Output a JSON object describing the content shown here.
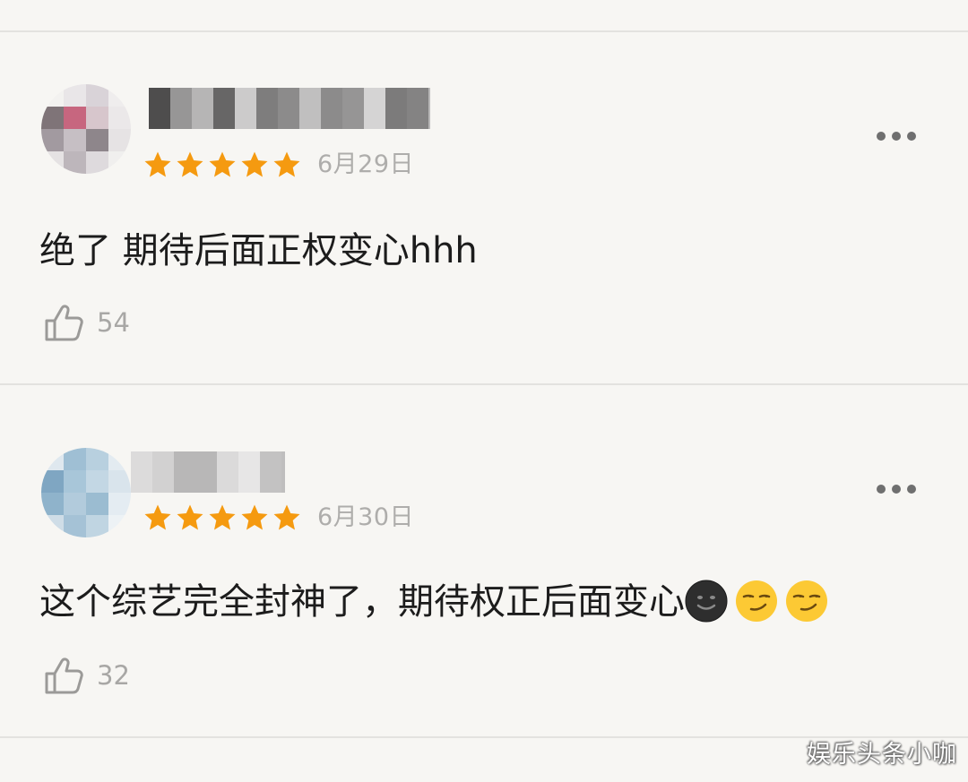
{
  "reviews": [
    {
      "rating": 5,
      "date": "6月29日",
      "content": "绝了 期待后面正权变心hhh",
      "emojis": [],
      "likes": "54",
      "avatar_palette": [
        "#f3f2f0",
        "#e9e6e8",
        "#d9d3d8",
        "#efeded",
        "#7f7478",
        "#c7667f",
        "#d7c6cc",
        "#ebe8e9",
        "#a29aa0",
        "#c6bfc4",
        "#8e868b",
        "#e6e3e4",
        "#e5e2e3",
        "#bdb6bb",
        "#dedadd",
        "#f0efee"
      ],
      "username_palette": [
        "#3b3b3b",
        "#6d6d6d",
        "#9a9a9a",
        "#565656",
        "#b9b9b9",
        "#4a4a4a",
        "#7f7f7f",
        "#a8a8a8",
        "#5e5e5e",
        "#8b8b8b",
        "#c6c6c6",
        "#474747",
        "#777777",
        "#a0a0a0"
      ]
    },
    {
      "rating": 5,
      "date": "6月30日",
      "content": "这个综艺完全封神了，期待权正后面变心",
      "emojis": [
        "dark-smiling-moon-face",
        "smirking-face",
        "smirking-face"
      ],
      "likes": "32",
      "avatar_palette": [
        "#dfe8ef",
        "#9fbfd4",
        "#b8d0df",
        "#e3ebf1",
        "#7fa6c2",
        "#a8c6d9",
        "#c3d7e4",
        "#d9e4ec",
        "#8fb3cb",
        "#b2cbdc",
        "#9bbcd1",
        "#e4ecf2",
        "#cfdde7",
        "#a5c2d6",
        "#c0d5e2",
        "#edf2f5"
      ],
      "username_palette": [
        "#d8d8d8",
        "#c2c2c2",
        "#9d9d9d",
        "#b0b0b0",
        "#cfcfcf",
        "#e0e0e0",
        "#bdbdbd",
        "#a7a7a7"
      ]
    }
  ],
  "watermark": "娱乐头条小咖",
  "colors": {
    "star": "#f59a10",
    "background": "#f7f6f3",
    "divider": "#e3e2df",
    "date_text": "#aeadab",
    "content_text": "#1c1c1c",
    "like_icon": "#9b9a98"
  },
  "icons": {
    "more": "more-dots-icon",
    "like": "thumbs-up-icon",
    "star": "star-icon"
  }
}
